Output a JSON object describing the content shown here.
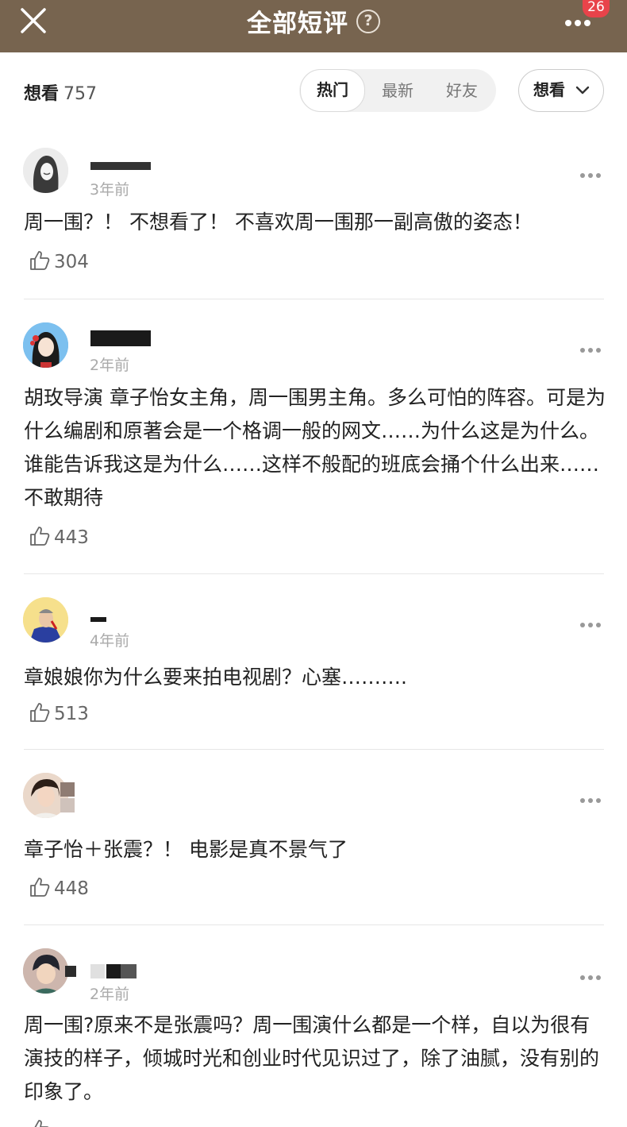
{
  "header": {
    "title": "全部短评",
    "help_icon": "question-circle-icon",
    "close_icon": "close-icon",
    "more_icon": "more-horizontal-icon",
    "badge_count": "26",
    "bg_color": "#77644f"
  },
  "filter": {
    "want_label": "想看",
    "want_count": "757",
    "tabs": [
      {
        "label": "热门",
        "active": true
      },
      {
        "label": "最新",
        "active": false
      },
      {
        "label": "好友",
        "active": false
      }
    ],
    "dropdown_label": "想看",
    "dropdown_icon": "chevron-down-icon"
  },
  "reviews": [
    {
      "time": "3年前",
      "text": "周一围？！ 不想看了！ 不喜欢周一围那一副高傲的姿态！",
      "likes": "304"
    },
    {
      "time": "2年前",
      "text": "胡玫导演 章子怡女主角，周一围男主角。多么可怕的阵容。可是为什么编剧和原著会是一个格调一般的网文……为什么这是为什么。谁能告诉我这是为什么……这样不般配的班底会捅个什么出来……不敢期待",
      "likes": "443"
    },
    {
      "time": "4年前",
      "text": "章娘娘你为什么要来拍电视剧？心塞……….",
      "likes": "513"
    },
    {
      "time": "",
      "text": "章子怡＋张震？！ 电影是真不景气了",
      "likes": "448"
    },
    {
      "time": "2年前",
      "text": "周一围?原来不是张震吗？周一围演什么都是一个样，自以为很有演技的样子，倾城时光和创业时代见识过了，除了油腻，没有别的印象了。",
      "likes": ""
    }
  ],
  "icons": {
    "like": "thumbs-up-icon",
    "review_more": "more-horizontal-icon"
  }
}
